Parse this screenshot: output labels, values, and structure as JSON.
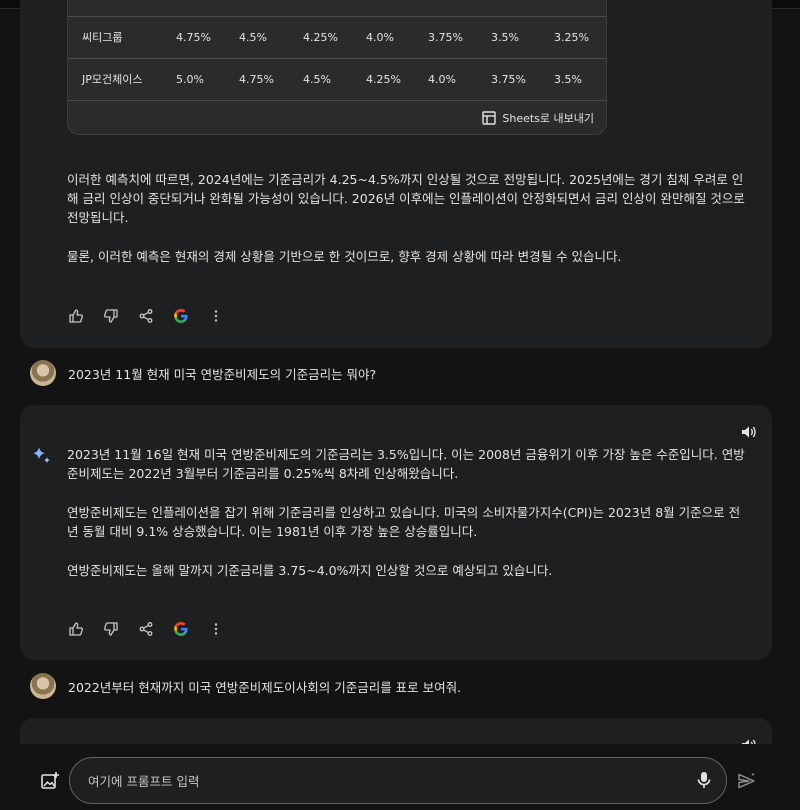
{
  "rate_table": {
    "rows": [
      {
        "bank": "씨티그룹",
        "values": [
          "4.75%",
          "4.5%",
          "4.25%",
          "4.0%",
          "3.75%",
          "3.5%",
          "3.25%"
        ]
      },
      {
        "bank": "JP모건체이스",
        "values": [
          "5.0%",
          "4.75%",
          "4.5%",
          "4.25%",
          "4.0%",
          "3.75%",
          "3.5%"
        ]
      }
    ],
    "export_label": "Sheets로 내보내기"
  },
  "response_1": {
    "para_1": "이러한 예측치에 따르면, 2024년에는 기준금리가 4.25~4.5%까지 인상될 것으로 전망됩니다. 2025년에는 경기 침체 우려로 인해 금리 인상이 중단되거나 완화될 가능성이 있습니다. 2026년 이후에는 인플레이션이 안정화되면서 금리 인상이 완만해질 것으로 전망됩니다.",
    "para_2": "물론, 이러한 예측은 현재의 경제 상황을 기반으로 한 것이므로, 향후 경제 상황에 따라 변경될 수 있습니다."
  },
  "user_prompt_1": "2023년 11월 현재 미국 연방준비제도의 기준금리는 뭐야?",
  "response_2": {
    "para_1": "2023년 11월 16일 현재 미국 연방준비제도의 기준금리는 3.5%입니다. 이는 2008년 금융위기 이후 가장 높은 수준입니다. 연방준비제도는 2022년 3월부터 기준금리를 0.25%씩 8차례 인상해왔습니다.",
    "para_2": "연방준비제도는 인플레이션을 잡기 위해 기준금리를 인상하고 있습니다. 미국의 소비자물가지수(CPI)는 2023년 8월 기준으로 전년 동월 대비 9.1% 상승했습니다. 이는 1981년 이후 가장 높은 상승률입니다.",
    "para_3": "연방준비제도는 올해 말까지 기준금리를 3.75~4.0%까지 인상할 것으로 예상되고 있습니다."
  },
  "user_prompt_2": "2022년부터 현재까지 미국 연방준비제도이사회의 기준금리를 표로 보여줘.",
  "input": {
    "placeholder": "여기에 프롬프트 입력"
  },
  "icons": [
    "thumb-up-icon",
    "thumb-down-icon",
    "share-icon",
    "google-icon",
    "more-vert-icon",
    "sparkle-icon",
    "speaker-icon",
    "image-add-icon",
    "mic-icon",
    "send-icon",
    "sheets-icon"
  ],
  "colors": {
    "background": "#131314",
    "card": "#1e1f20",
    "text": "#e3e3e3",
    "sparkle": "#8ab4f8"
  }
}
